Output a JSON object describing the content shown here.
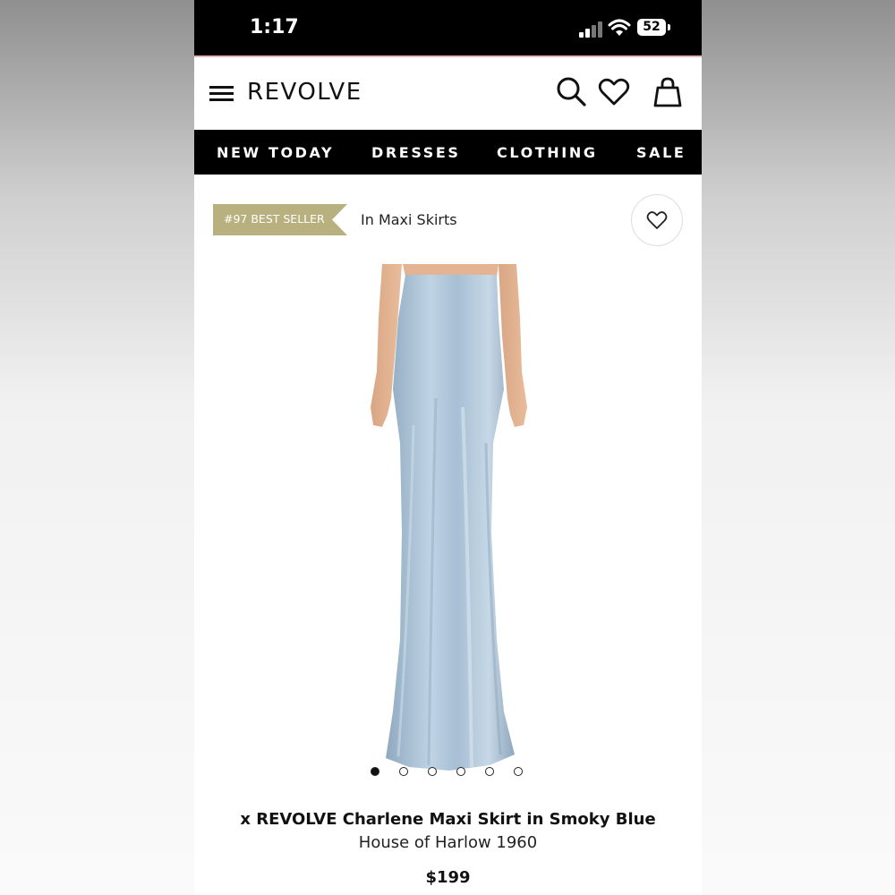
{
  "status_bar": {
    "time": "1:17",
    "battery": "52"
  },
  "header": {
    "logo": "REVOLVE",
    "icons": [
      "menu-icon",
      "search-icon",
      "heart-icon",
      "bag-icon"
    ]
  },
  "nav": {
    "items": [
      {
        "label": "NEW TODAY"
      },
      {
        "label": "DRESSES"
      },
      {
        "label": "CLOTHING"
      },
      {
        "label": "SALE"
      }
    ]
  },
  "product": {
    "badge": "#97 BEST SELLER",
    "category": "In Maxi Skirts",
    "title": "x REVOLVE Charlene Maxi Skirt in Smoky Blue",
    "brand": "House of Harlow 1960",
    "price": "$199",
    "image_count": 6,
    "active_image": 1
  },
  "colors": {
    "badge": "#b8b07e",
    "skirt": "#a9c1d6",
    "nav_bg": "#000000"
  }
}
